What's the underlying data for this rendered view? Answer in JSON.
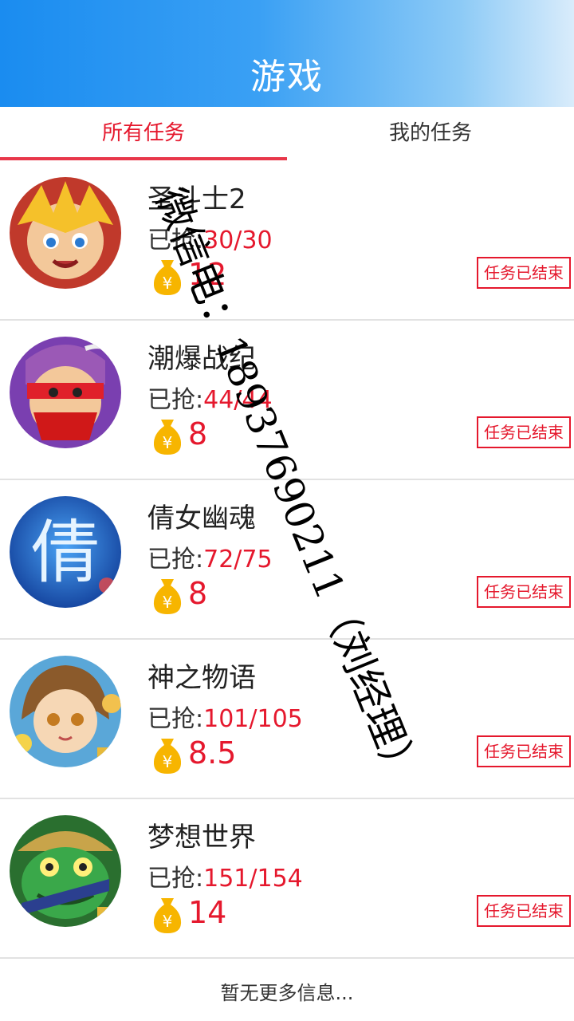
{
  "header": {
    "title": "游戏"
  },
  "tabs": [
    {
      "label": "所有任务",
      "active": true
    },
    {
      "label": "我的任务",
      "active": false
    }
  ],
  "grabbed_label": "已抢:",
  "games": [
    {
      "name": "圣斗士2",
      "grabbed": "30/30",
      "reward": "12",
      "status": "任务已结束",
      "avatar_icon": "saint-warrior-icon",
      "colors": [
        "#f5c12a",
        "#2b7ad0",
        "#c0392b"
      ]
    },
    {
      "name": "潮爆战纪",
      "grabbed": "44/44",
      "reward": "8",
      "status": "任务已结束",
      "avatar_icon": "ninja-warrior-icon",
      "colors": [
        "#7a3fb0",
        "#e0202a",
        "#f3c89a"
      ]
    },
    {
      "name": "倩女幽魂",
      "grabbed": "72/75",
      "reward": "8",
      "status": "任务已结束",
      "avatar_icon": "qian-character-icon",
      "colors": [
        "#1e5cc8",
        "#3a8be8",
        "#dff1ff"
      ]
    },
    {
      "name": "神之物语",
      "grabbed": "101/105",
      "reward": "8.5",
      "status": "任务已结束",
      "avatar_icon": "girl-hero-icon",
      "colors": [
        "#5aa7d8",
        "#8b5a2b",
        "#f6d7b5"
      ]
    },
    {
      "name": "梦想世界",
      "grabbed": "151/154",
      "reward": "14",
      "status": "任务已结束",
      "avatar_icon": "frog-warrior-icon",
      "colors": [
        "#3aa84a",
        "#c8a44a",
        "#2a6f2f"
      ]
    }
  ],
  "footer": {
    "text": "暂无更多信息..."
  },
  "watermark": {
    "text": "微信电：18937690211（刘经理）"
  },
  "accent_color": "#e5182d"
}
